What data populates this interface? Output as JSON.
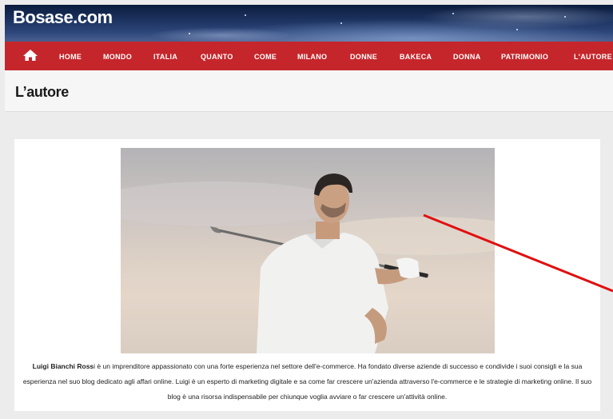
{
  "site": {
    "brand": "Bosase.com"
  },
  "nav": {
    "home_icon": "home-icon",
    "items": [
      "HOME",
      "MONDO",
      "ITALIA",
      "QUANTO",
      "COME",
      "MILANO",
      "DONNE",
      "BAKECA",
      "DONNA",
      "PATRIMONIO",
      "L'AUTORE"
    ]
  },
  "page": {
    "title": "L’autore"
  },
  "author": {
    "name": "Luigi Bianchi Ross",
    "bio_rest": "i è un imprenditore appassionato con una forte esperienza nel settore dell'e-commerce. Ha fondato diverse aziende di successo e condivide i suoi consigli e la sua esperienza nel suo blog dedicato agli affari online. Luigi è un esperto di marketing digitale e sa come far crescere un'azienda attraverso l'e-commerce e le strategie di marketing online. Il suo blog è una risorsa indispensabile per chiunque voglia avviare o far crescere un'attività online."
  },
  "colors": {
    "nav_bg": "#c5262b",
    "annotation_arrow": "#e01010"
  }
}
